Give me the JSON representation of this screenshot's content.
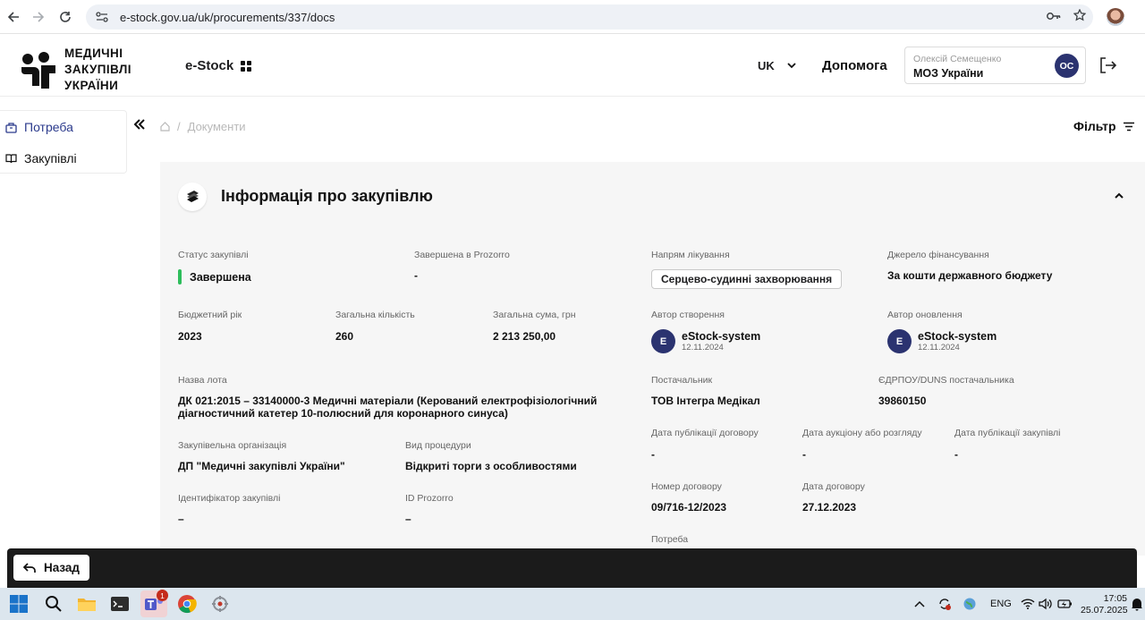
{
  "browser": {
    "url": "e-stock.gov.ua/uk/procurements/337/docs"
  },
  "header": {
    "logo_lines": [
      "МЕДИЧНІ",
      "ЗАКУПІВЛІ",
      "УКРАЇНИ"
    ],
    "app_name": "e-Stock",
    "language": "UK",
    "help": "Допомога",
    "user_name": "Олексій Семещенко",
    "user_org": "МОЗ України",
    "user_initials": "ОС"
  },
  "sidebar": {
    "items": [
      {
        "label": "Потреба",
        "icon": "needs-icon"
      },
      {
        "label": "Закупівлі",
        "icon": "book-icon"
      }
    ]
  },
  "breadcrumb": {
    "current": "Документи"
  },
  "filter_label": "Фільтр",
  "card": {
    "title": "Інформація про закупівлю",
    "status_label": "Статус закупівлі",
    "status_value": "Завершена",
    "prozorro_done_label": "Завершена в Prozorro",
    "prozorro_done_value": "-",
    "treatment_label": "Напрям лікування",
    "treatment_value": "Серцево-судинні захворювання",
    "funding_label": "Джерело фінансування",
    "funding_value": "За кошти державного бюджету",
    "budget_year_label": "Бюджетний рік",
    "budget_year_value": "2023",
    "quantity_label": "Загальна кількість",
    "quantity_value": "260",
    "total_label": "Загальна сума, грн",
    "total_value": "2 213 250,00",
    "created_by_label": "Автор створення",
    "created_by_initial": "E",
    "created_by_name": "eStock-system",
    "created_by_date": "12.11.2024",
    "updated_by_label": "Автор оновлення",
    "updated_by_initial": "E",
    "updated_by_name": "eStock-system",
    "updated_by_date": "12.11.2024",
    "lot_label": "Назва лота",
    "lot_value": "ДК 021:2015 – 33140000-3 Медичні матеріали (Керований електрофізіологічний діагностичний катетер 10-полюсний для коронарного синуса)",
    "supplier_label": "Постачальник",
    "supplier_value": "ТОВ Інтегра Медікал",
    "edrpou_label": "ЄДРПОУ/DUNS постачальника",
    "edrpou_value": "39860150",
    "org_label": "Закупівельна організація",
    "org_value": "ДП \"Медичні закупівлі України\"",
    "procedure_label": "Вид процедури",
    "procedure_value": "Відкриті торги з особливостями",
    "contract_pub_label": "Дата публікації договору",
    "contract_pub_value": "-",
    "auction_label": "Дата аукціону або розгляду",
    "auction_value": "-",
    "procurement_pub_label": "Дата публікації закупівлі",
    "procurement_pub_value": "-",
    "proc_id_label": "Ідентифікатор закупівлі",
    "proc_id_value": "–",
    "prozorro_id_label": "ID Prozorro",
    "prozorro_id_value": "–",
    "contract_num_label": "Номер договору",
    "contract_num_value": "09/716-12/2023",
    "contract_date_label": "Дата договору",
    "contract_date_value": "27.12.2023",
    "need_label": "Потреба"
  },
  "bottom_bar": {
    "back_label": "Назад"
  },
  "taskbar": {
    "teams_badge": "1",
    "lang": "ENG",
    "time": "17:05",
    "date": "25.07.2025"
  }
}
